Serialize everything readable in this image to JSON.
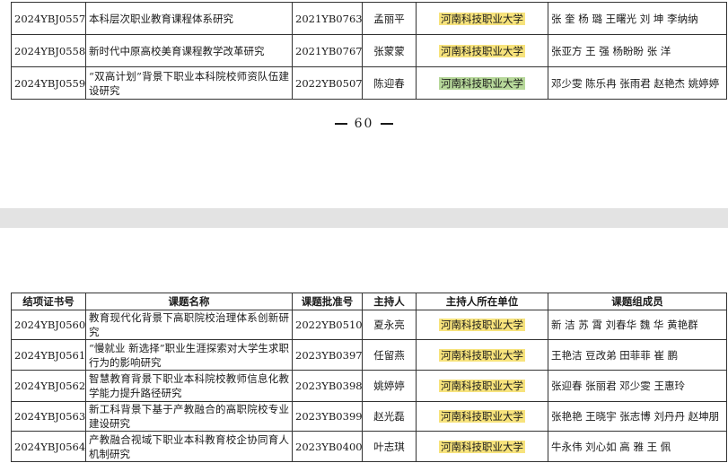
{
  "top_rows": [
    {
      "id": "2024YBJ0557",
      "title": "本科层次职业教育课程体系研究",
      "batch": "2021YB0763",
      "host": "孟丽平",
      "unit": "河南科技职业大学",
      "members": "张 奎 杨 璐 王曙光 刘 坤 李纳纳"
    },
    {
      "id": "2024YBJ0558",
      "title": "新时代中原高校美育课程教学改革研究",
      "batch": "2021YB0767",
      "host": "张蒙蒙",
      "unit": "河南科技职业大学",
      "members": "张亚方 王 强 杨盼盼 张 洋"
    },
    {
      "id": "2024YBJ0559",
      "title": "“双高计划”背景下职业本科院校师资队伍建设研究",
      "batch": "2022YB0507",
      "host": "陈迎春",
      "unit": "河南科技职业大学",
      "members": "邓少雯 陈乐冉 张雨君 赵艳杰 姚婷婷"
    }
  ],
  "page_number": "60",
  "headers": {
    "id": "结项证书号",
    "title": "课题名称",
    "batch": "课题批准号",
    "host": "主持人",
    "unit": "主持人所在单位",
    "members": "课题组成员"
  },
  "bottom_rows": [
    {
      "id": "2024YBJ0560",
      "title": "教育现代化背景下高职院校治理体系创新研究",
      "batch": "2022YB0510",
      "host": "夏永亮",
      "unit": "河南科技职业大学",
      "members": "新 洁 苏 霄 刘春华 魏 华 黄艳群"
    },
    {
      "id": "2024YBJ0561",
      "title": "“慢就业 新选择”职业生涯探索对大学生求职行为的影响研究",
      "batch": "2023YB0397",
      "host": "任留燕",
      "unit": "河南科技职业大学",
      "members": "王艳洁 豆改弟 田菲菲 崔 鹏"
    },
    {
      "id": "2024YBJ0562",
      "title": "智慧教育背景下职业本科院校教师信息化教学能力提升路径研究",
      "batch": "2023YB0398",
      "host": "姚婷婷",
      "unit": "河南科技职业大学",
      "members": "张迎春 张丽君 邓少雯 王惠玲"
    },
    {
      "id": "2024YBJ0563",
      "title": "新工科背景下基于产教融合的高职院校专业建设研究",
      "batch": "2023YB0399",
      "host": "赵光磊",
      "unit": "河南科技职业大学",
      "members": "张艳艳 王晓宇 张志博 刘丹丹 赵坤朋"
    },
    {
      "id": "2024YBJ0564",
      "title": "产教融合视域下职业本科教育校企协同育人机制研究",
      "batch": "2023YB0400",
      "host": "叶志琪",
      "unit": "河南科技职业大学",
      "members": "牛永伟 刘心如 高 雅 王 佩"
    }
  ]
}
